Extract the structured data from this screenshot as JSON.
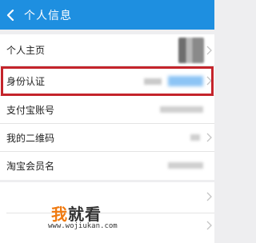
{
  "header": {
    "title": "个人信息",
    "bg_color": "#1e8fe0",
    "back_icon": "chevron-left-icon"
  },
  "rows": {
    "home": "个人主页",
    "identity": "身份认证",
    "alipay_account": "支付宝账号",
    "qr_code": "我的二维码",
    "taobao_name": "淘宝会员名"
  },
  "highlight_color": "#c4242b",
  "watermark": {
    "text": "我就看",
    "url": "www.wojiukan.com"
  }
}
